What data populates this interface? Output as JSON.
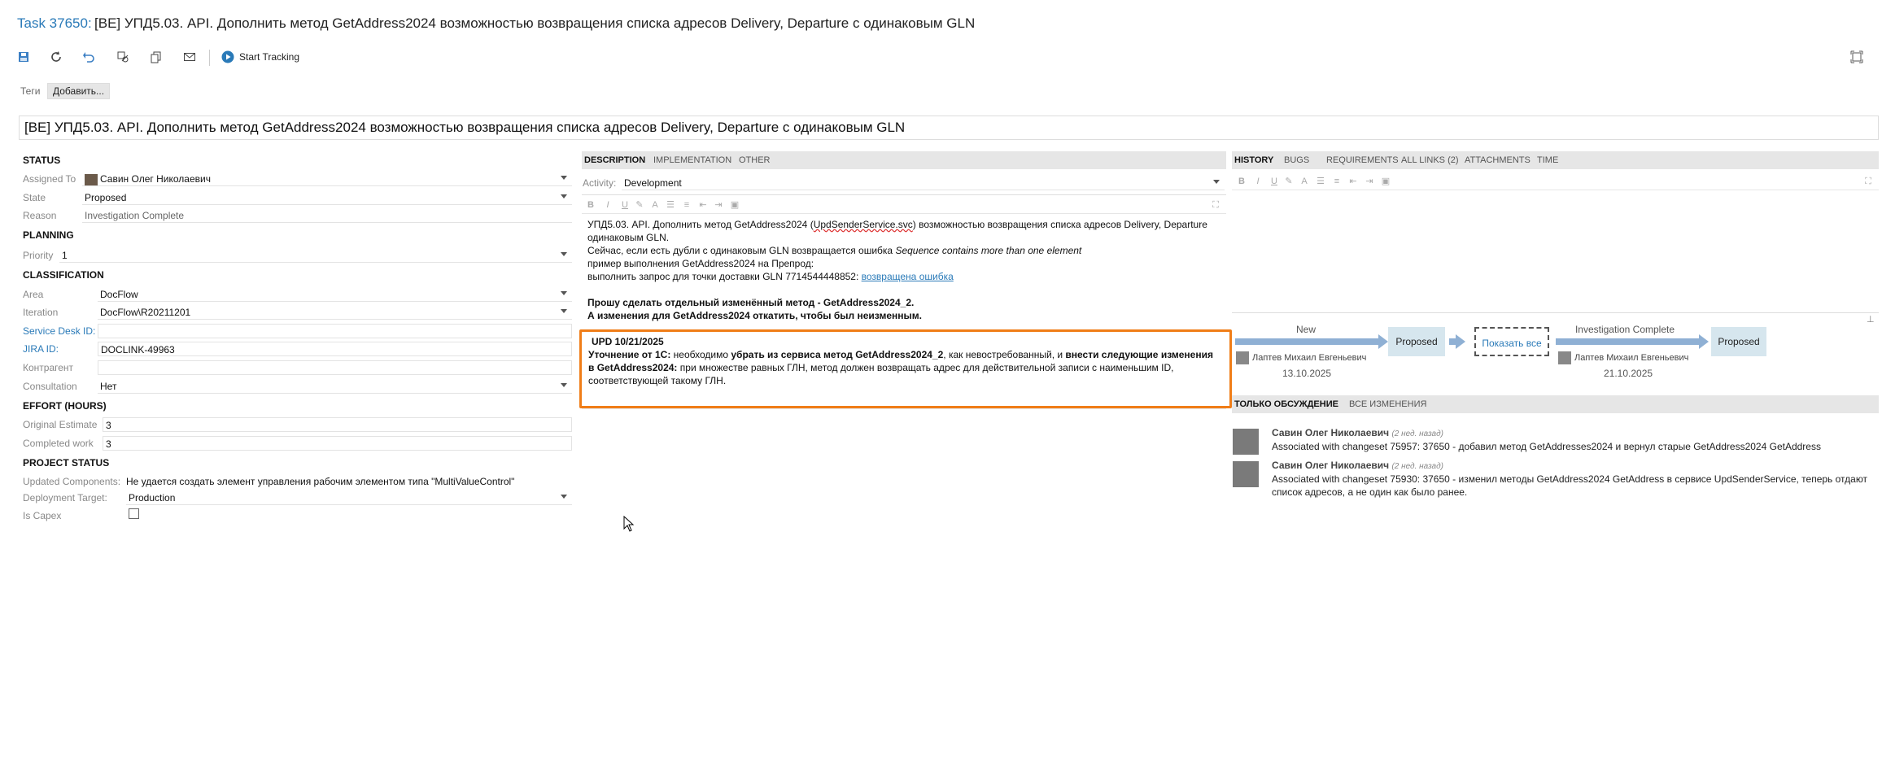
{
  "header": {
    "task_ref": "Task 37650:",
    "title": "[BE] УПД5.03. API. Дополнить метод GetAddress2024 возможностью возвращения списка адресов Delivery, Departure с одинаковым GLN"
  },
  "toolbar": {
    "start_tracking": "Start Tracking",
    "icons": [
      "save-icon",
      "refresh-icon",
      "undo-icon",
      "link-icon",
      "copy-icon",
      "mail-icon",
      "play-icon",
      "maximize-icon"
    ]
  },
  "tags": {
    "label": "Теги",
    "add_button": "Добавить..."
  },
  "title_field": "[BE] УПД5.03. API. Дополнить метод GetAddress2024 возможностью возвращения списка адресов Delivery, Departure с одинаковым GLN",
  "left": {
    "status_header": "STATUS",
    "assigned_to_label": "Assigned To",
    "assigned_to_value": "Савин Олег Николаевич",
    "state_label": "State",
    "state_value": "Proposed",
    "reason_label": "Reason",
    "reason_value": "Investigation Complete",
    "planning_header": "PLANNING",
    "priority_label": "Priority",
    "priority_value": "1",
    "classification_header": "CLASSIFICATION",
    "area_label": "Area",
    "area_value": "DocFlow",
    "iteration_label": "Iteration",
    "iteration_value": "DocFlow\\R20211201",
    "service_desk_label": "Service Desk ID:",
    "service_desk_value": "",
    "jira_label": "JIRA ID:",
    "jira_value": "DOCLINK-49963",
    "kontragent_label": "Контрагент",
    "kontragent_value": "",
    "consultation_label": "Consultation",
    "consultation_value": "Нет",
    "effort_header": "EFFORT (HOURS)",
    "orig_est_label": "Original Estimate",
    "orig_est_value": "3",
    "completed_label": "Completed work",
    "completed_value": "3",
    "project_header": "PROJECT STATUS",
    "updated_components_label": "Updated Components:",
    "updated_components_value": "Не удается создать элемент управления рабочим элементом типа \"MultiValueControl\"",
    "deployment_label": "Deployment Target:",
    "deployment_value": "Production",
    "capex_label": "Is Capex"
  },
  "middle": {
    "tabs": [
      "DESCRIPTION",
      "IMPLEMENTATION",
      "OTHER"
    ],
    "activity_label": "Activity:",
    "activity_value": "Development",
    "desc": {
      "l1a": "УПД5.03. API. Дополнить метод GetAddress2024 (",
      "l1u": "UpdSenderService.svc",
      "l1b": ") возможностью возвращения списка адресов Delivery, Departure",
      "l2": "одинаковым GLN.",
      "l3a": "Сейчас, если есть дубли с одинаковым GLN возвращается ошибка ",
      "l3i": "Sequence contains more than one element",
      "l4": "пример  выполнения  GetAddress2024 на Препрод:",
      "l5a": "выполнить запрос для точки доставки  GLN 7714544448852: ",
      "l5link": "возвращена ошибка",
      "l6": "Прошу сделать отдельный изменённый метод - GetAddress2024_2.",
      "l7": "А изменения для GetAddress2024 откатить, чтобы был неизменным.",
      "upd_title": "UPD 10/21/2025",
      "upd_b1": "Уточнение от 1С:",
      "upd_t1": " необходимо ",
      "upd_b2": "убрать из сервиса метод GetAddress2024_2",
      "upd_t2": ", как невостребованный, и ",
      "upd_b3": "внести следующие изменения",
      "upd_b4": "в GetAddress2024:",
      "upd_t3": " при множестве равных ГЛН, метод должен возвращать адрес для действительной записи с наименьшим ID,",
      "upd_t4": "соответствующей такому ГЛН."
    }
  },
  "right": {
    "tabs": [
      "HISTORY",
      "BUGS",
      "REQUIREMENTS",
      "ALL LINKS (2)",
      "ATTACHMENTS",
      "TIME"
    ],
    "flow": {
      "new_label": "New",
      "proposed1": "Proposed",
      "show_all": "Показать все",
      "investigation_label": "Investigation Complete",
      "proposed2": "Proposed",
      "person1": "Лаптев Михаил Евгеньевич",
      "date1": "13.10.2025",
      "person2": "Лаптев Михаил Евгеньевич",
      "date2": "21.10.2025"
    },
    "disc_tabs": [
      "ТОЛЬКО ОБСУЖДЕНИЕ",
      "ВСЕ ИЗМЕНЕНИЯ"
    ],
    "discussion": [
      {
        "name": "Савин Олег Николаевич",
        "ago": "(2 нед. назад)",
        "line1": "Associated with changeset 75957: 37650 - добавил метод GetAddresses2024 и вернул старые GetAddress2024 GetAddress",
        "line2": ""
      },
      {
        "name": "Савин Олег Николаевич",
        "ago": "(2 нед. назад)",
        "line1": "Associated with changeset 75930: 37650 - изменил методы GetAddress2024 GetAddress в сервисе UpdSenderService, теперь отдают",
        "line2": "список адресов, а не один как было ранее."
      }
    ]
  },
  "colors": {
    "accent": "#2a7ab8",
    "highlight_border": "#f07d17",
    "state_box": "#d6e6ee",
    "arrow": "#8fb0d4"
  }
}
